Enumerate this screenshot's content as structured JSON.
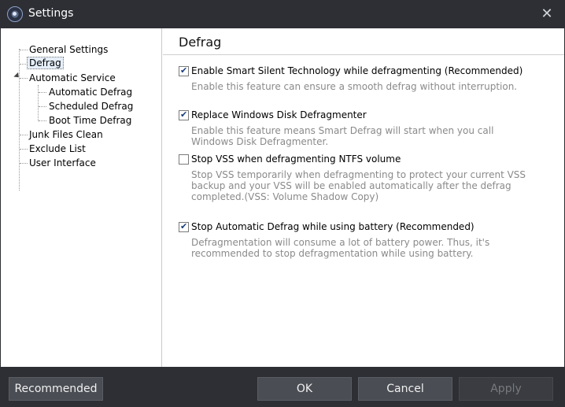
{
  "window": {
    "title": "Settings"
  },
  "tree": {
    "items": [
      {
        "label": "General Settings"
      },
      {
        "label": "Defrag"
      },
      {
        "label": "Automatic Service"
      },
      {
        "label": "Automatic Defrag"
      },
      {
        "label": "Scheduled Defrag"
      },
      {
        "label": "Boot Time Defrag"
      },
      {
        "label": "Junk Files Clean"
      },
      {
        "label": "Exclude List"
      },
      {
        "label": "User Interface"
      }
    ]
  },
  "panel": {
    "title": "Defrag",
    "options": [
      {
        "label": "Enable Smart Silent Technology while defragmenting (Recommended)",
        "checked": true,
        "desc": "Enable this feature can ensure a smooth defrag without interruption."
      },
      {
        "label": "Replace Windows Disk Defragmenter",
        "checked": true,
        "desc": "Enable this feature means Smart Defrag will start when you call Windows Disk Defragmenter."
      },
      {
        "label": "Stop VSS when defragmenting NTFS volume",
        "checked": false,
        "desc": "Stop VSS temporarily when defragmenting to protect your current VSS backup and your VSS will be enabled automatically after the defrag completed.(VSS: Volume Shadow Copy)"
      },
      {
        "label": "Stop Automatic Defrag while using battery (Recommended)",
        "checked": true,
        "desc": "Defragmentation will consume a lot of battery power. Thus, it's recommended to stop defragmentation while using battery."
      }
    ]
  },
  "footer": {
    "recommended_label": "Recommended",
    "ok_label": "OK",
    "cancel_label": "Cancel",
    "apply_label": "Apply"
  }
}
